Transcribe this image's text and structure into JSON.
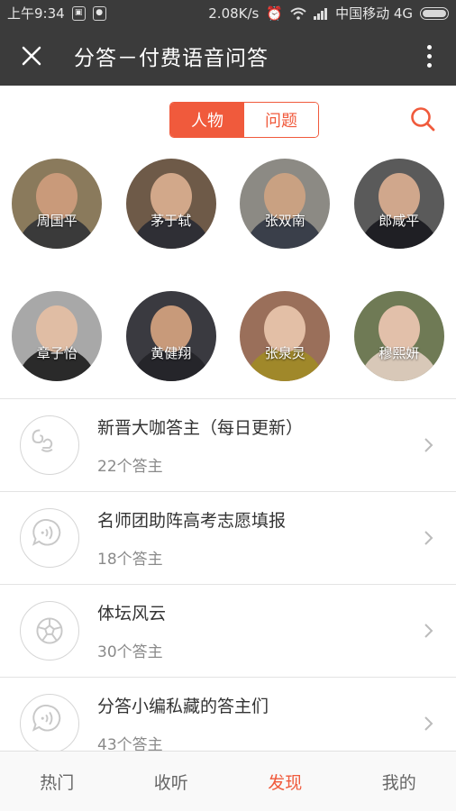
{
  "status_bar": {
    "time": "上午9:34",
    "speed": "2.08K/s",
    "carrier": "中国移动 4G"
  },
  "app_bar": {
    "title": "分答－付费语音问答"
  },
  "tabs": {
    "people": "人物",
    "questions": "问题",
    "active": "people"
  },
  "people": [
    {
      "name": "周国平",
      "bg": "#8a7a5c",
      "skin": "#c99a7a",
      "cloth": "#3a3a3a"
    },
    {
      "name": "茅于轼",
      "bg": "#6e5a48",
      "skin": "#d2a88a",
      "cloth": "#2f2f35"
    },
    {
      "name": "张双南",
      "bg": "#8c8a84",
      "skin": "#c9a182",
      "cloth": "#3a3f4a"
    },
    {
      "name": "郎咸平",
      "bg": "#5a5a5a",
      "skin": "#d0a78c",
      "cloth": "#1f1f24"
    },
    {
      "name": "章子怡",
      "bg": "#a8a8a8",
      "skin": "#e0bda4",
      "cloth": "#2a2a2a"
    },
    {
      "name": "黄健翔",
      "bg": "#3a3a40",
      "skin": "#c89a7a",
      "cloth": "#25252a"
    },
    {
      "name": "张泉灵",
      "bg": "#9a6f5a",
      "skin": "#e3bfa6",
      "cloth": "#a0882a"
    },
    {
      "name": "穆熙妍",
      "bg": "#6f7a55",
      "skin": "#e2c0aa",
      "cloth": "#d8c8b8"
    }
  ],
  "list": [
    {
      "title": "新晋大咖答主（每日更新）",
      "count": "22个答主",
      "icon": "squirrel-icon"
    },
    {
      "title": "名师团助阵高考志愿填报",
      "count": "18个答主",
      "icon": "voice-bubble-icon"
    },
    {
      "title": "体坛风云",
      "count": "30个答主",
      "icon": "soccer-ball-icon"
    },
    {
      "title": "分答小编私藏的答主们",
      "count": "43个答主",
      "icon": "voice-bubble-icon"
    }
  ],
  "bottom_nav": {
    "hot": "热门",
    "listen": "收听",
    "discover": "发现",
    "mine": "我的",
    "active": "discover"
  },
  "colors": {
    "accent": "#f05a3c",
    "bar": "#3b3b3b"
  }
}
